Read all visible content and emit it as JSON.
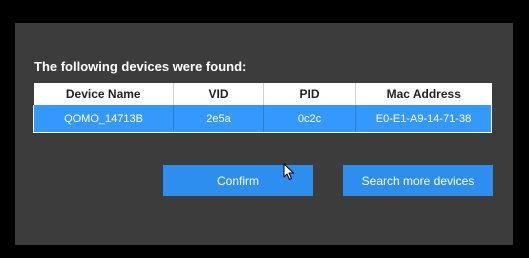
{
  "dialog": {
    "heading": "The following devices were found:"
  },
  "table": {
    "columns": [
      "Device Name",
      "VID",
      "PID",
      "Mac Address"
    ],
    "rows": [
      {
        "device_name": "QOMO_14713B",
        "vid": "2e5a",
        "pid": "0c2c",
        "mac_address": "E0-E1-A9-14-71-38",
        "selected": true
      }
    ]
  },
  "buttons": {
    "confirm_label": "Confirm",
    "search_more_label": "Search more devices"
  },
  "colors": {
    "window_bg": "#000000",
    "dialog_bg": "#3c3c3c",
    "accent": "#3399ff",
    "button": "#2d8ef0",
    "header_bg": "#ffffff"
  },
  "icons": {
    "cursor": "mouse-pointer-icon"
  }
}
